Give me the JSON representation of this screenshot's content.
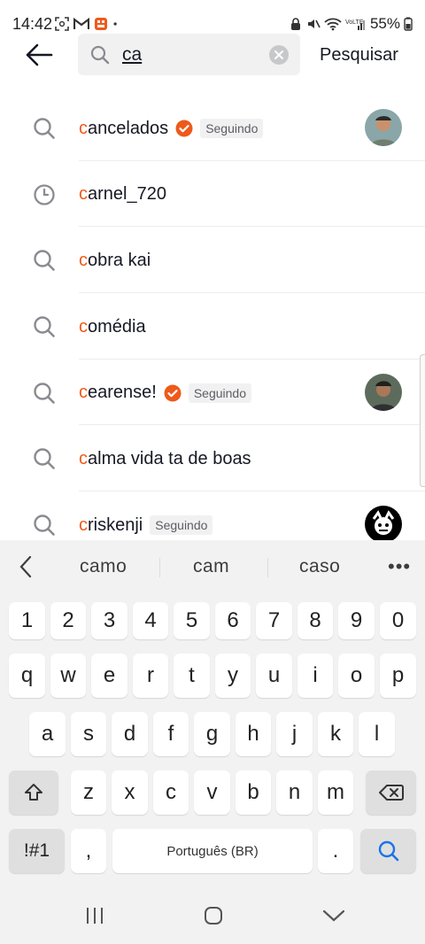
{
  "status_bar": {
    "time": "14:42",
    "battery": "55%",
    "icons_left": [
      "screenshot-icon",
      "gmail-icon",
      "app-icon",
      "dot-icon"
    ],
    "icons_right": [
      "lock-icon",
      "mute-icon",
      "wifi-icon",
      "signal-icon",
      "battery-icon"
    ]
  },
  "header": {
    "search_value": "ca",
    "search_action": "Pesquisar"
  },
  "suggestions": [
    {
      "highlight": "c",
      "rest": "ancelados",
      "icon": "search-icon",
      "verified": true,
      "badge": "Seguindo",
      "avatar": true
    },
    {
      "highlight": "c",
      "rest": "arnel_720",
      "icon": "history-clock-icon",
      "verified": false,
      "badge": "",
      "avatar": false
    },
    {
      "highlight": "c",
      "rest": "obra kai",
      "icon": "search-icon",
      "verified": false,
      "badge": "",
      "avatar": false
    },
    {
      "highlight": "c",
      "rest": "omédia",
      "icon": "search-icon",
      "verified": false,
      "badge": "",
      "avatar": false
    },
    {
      "highlight": "c",
      "rest": "earense!",
      "icon": "search-icon",
      "verified": true,
      "badge": "Seguindo",
      "avatar": true
    },
    {
      "highlight": "c",
      "rest": "alma vida ta de boas",
      "icon": "search-icon",
      "verified": false,
      "badge": "",
      "avatar": false
    },
    {
      "highlight": "c",
      "rest": "riskenji",
      "icon": "search-icon",
      "verified": false,
      "badge": "Seguindo",
      "avatar": true
    }
  ],
  "keyboard": {
    "predictions": [
      "camo",
      "cam",
      "caso"
    ],
    "more": "•••",
    "number_row": [
      "1",
      "2",
      "3",
      "4",
      "5",
      "6",
      "7",
      "8",
      "9",
      "0"
    ],
    "row1": [
      "q",
      "w",
      "e",
      "r",
      "t",
      "y",
      "u",
      "i",
      "o",
      "p"
    ],
    "row2": [
      "a",
      "s",
      "d",
      "f",
      "g",
      "h",
      "j",
      "k",
      "l"
    ],
    "row3": [
      "z",
      "x",
      "c",
      "v",
      "b",
      "n",
      "m"
    ],
    "symbols_key": "!#1",
    "comma_key": ",",
    "space_label": "Português (BR)",
    "period_key": "."
  },
  "colors": {
    "highlight": "#ee5a1a",
    "verified": "#ee5a1a",
    "search_key_icon": "#1a73e8"
  }
}
